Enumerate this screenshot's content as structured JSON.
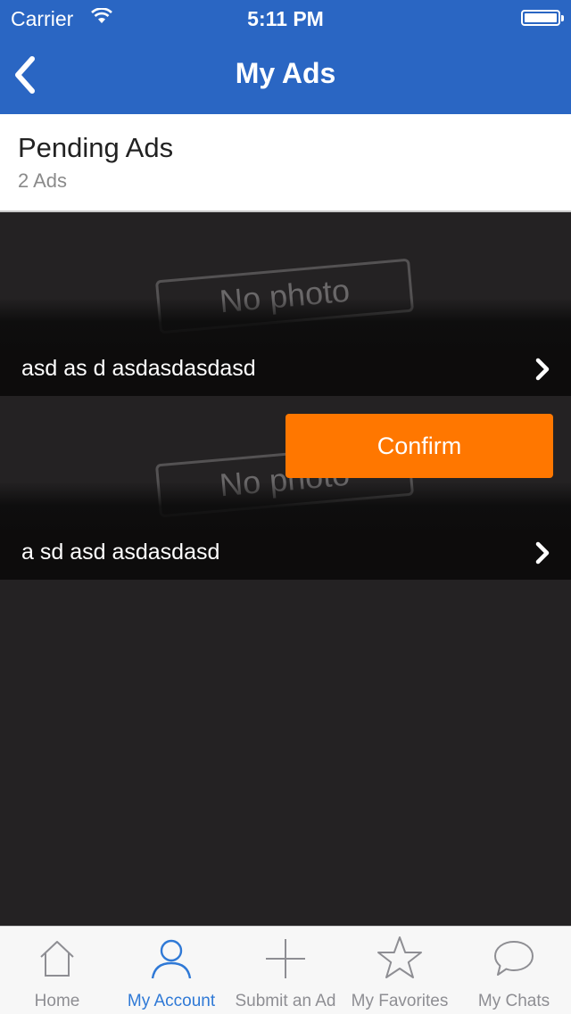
{
  "status_bar": {
    "carrier": "Carrier",
    "time": "5:11 PM"
  },
  "nav": {
    "title": "My Ads"
  },
  "section": {
    "title": "Pending Ads",
    "count": "2 Ads"
  },
  "ads": [
    {
      "title": "asd as d asdasdasdasd",
      "placeholder": "No photo"
    },
    {
      "title": "a sd asd asdasdasd",
      "placeholder": "No photo"
    }
  ],
  "confirm_label": "Confirm",
  "tabs": [
    {
      "label": "Home",
      "icon": "home-icon"
    },
    {
      "label": "My Account",
      "icon": "user-icon"
    },
    {
      "label": "Submit an Ad",
      "icon": "plus-icon"
    },
    {
      "label": "My Favorites",
      "icon": "star-icon"
    },
    {
      "label": "My Chats",
      "icon": "chat-bubble-icon"
    }
  ],
  "colors": {
    "nav": "#2a66c3",
    "confirm": "#ff7700",
    "active_tab": "#2f79d6",
    "inactive_tab": "#8e8e93"
  }
}
